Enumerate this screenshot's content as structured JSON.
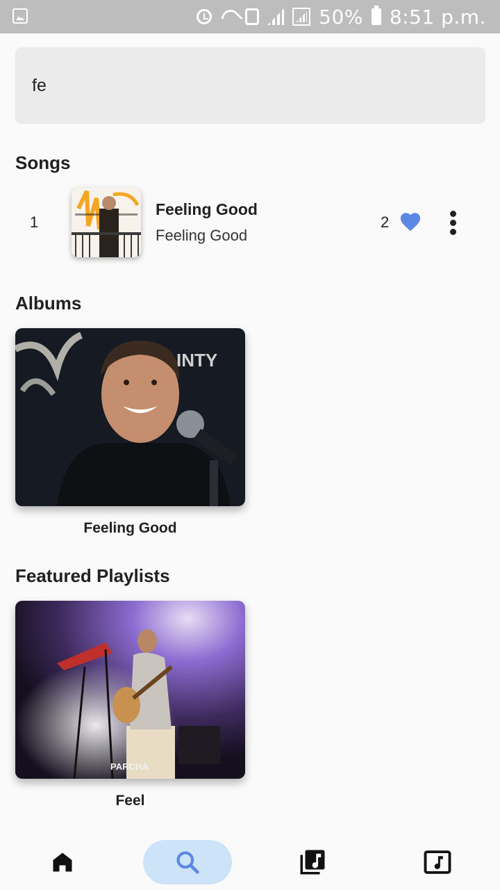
{
  "status_bar": {
    "battery": "50%",
    "time": "8:51 p.m.",
    "icons": [
      "gallery-icon",
      "alarm-icon",
      "wifi-icon",
      "data-saver-icon",
      "signal-icon",
      "signal-2-icon",
      "battery-icon"
    ]
  },
  "search": {
    "value": "fe",
    "placeholder": ""
  },
  "songs_section": {
    "title": "Songs",
    "items": [
      {
        "index": "1",
        "title": "Feeling Good",
        "artist": "Feeling Good",
        "likes": "2",
        "liked": true
      }
    ]
  },
  "albums_section": {
    "title": "Albums",
    "items": [
      {
        "name": "Feeling Good"
      }
    ]
  },
  "playlists_section": {
    "title": "Featured Playlists",
    "items": [
      {
        "name": "Feel",
        "image_text": "PARCHA"
      }
    ]
  },
  "bottom_nav": {
    "items": [
      {
        "name": "home",
        "icon": "home-icon",
        "active": false
      },
      {
        "name": "search",
        "icon": "search-icon",
        "active": true
      },
      {
        "name": "library",
        "icon": "library-music-icon",
        "active": false
      },
      {
        "name": "player",
        "icon": "music-note-icon",
        "active": false
      }
    ]
  },
  "colors": {
    "accent": "#5b87e5",
    "nav_active_bg": "#cde3f7",
    "search_bg": "#ebebeb",
    "background": "#fafafa"
  }
}
